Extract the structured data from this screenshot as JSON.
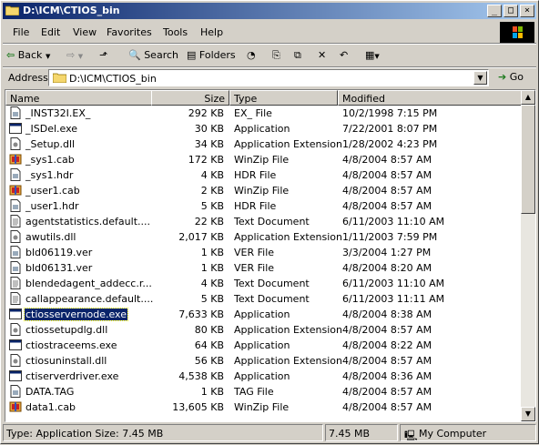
{
  "window": {
    "title": "D:\\ICM\\CTIOS_bin"
  },
  "menu": [
    "File",
    "Edit",
    "View",
    "Favorites",
    "Tools",
    "Help"
  ],
  "toolbar": {
    "back": "Back",
    "search": "Search",
    "folders": "Folders"
  },
  "address": {
    "label": "Address",
    "value": "D:\\ICM\\CTIOS_bin",
    "go": "Go"
  },
  "columns": {
    "name": "Name",
    "size": "Size",
    "type": "Type",
    "modified": "Modified"
  },
  "files": [
    {
      "name": "_INST32I.EX_",
      "size": "292 KB",
      "type": "EX_ File",
      "modified": "10/2/1998 7:15 PM",
      "icon": "generic-file-icon"
    },
    {
      "name": "_ISDel.exe",
      "size": "30 KB",
      "type": "Application",
      "modified": "7/22/2001 8:07 PM",
      "icon": "application-icon"
    },
    {
      "name": "_Setup.dll",
      "size": "34 KB",
      "type": "Application Extension",
      "modified": "1/28/2002 4:23 PM",
      "icon": "dll-icon"
    },
    {
      "name": "_sys1.cab",
      "size": "172 KB",
      "type": "WinZip File",
      "modified": "4/8/2004 8:57 AM",
      "icon": "winzip-icon"
    },
    {
      "name": "_sys1.hdr",
      "size": "4 KB",
      "type": "HDR File",
      "modified": "4/8/2004 8:57 AM",
      "icon": "generic-file-icon"
    },
    {
      "name": "_user1.cab",
      "size": "2 KB",
      "type": "WinZip File",
      "modified": "4/8/2004 8:57 AM",
      "icon": "winzip-icon"
    },
    {
      "name": "_user1.hdr",
      "size": "5 KB",
      "type": "HDR File",
      "modified": "4/8/2004 8:57 AM",
      "icon": "generic-file-icon"
    },
    {
      "name": "agentstatistics.default....",
      "size": "22 KB",
      "type": "Text Document",
      "modified": "6/11/2003 11:10 AM",
      "icon": "text-document-icon"
    },
    {
      "name": "awutils.dll",
      "size": "2,017 KB",
      "type": "Application Extension",
      "modified": "1/11/2003 7:59 PM",
      "icon": "dll-icon"
    },
    {
      "name": "bld06119.ver",
      "size": "1 KB",
      "type": "VER File",
      "modified": "3/3/2004 1:27 PM",
      "icon": "generic-file-icon"
    },
    {
      "name": "bld06131.ver",
      "size": "1 KB",
      "type": "VER File",
      "modified": "4/8/2004 8:20 AM",
      "icon": "generic-file-icon"
    },
    {
      "name": "blendedagent_addecc.r...",
      "size": "4 KB",
      "type": "Text Document",
      "modified": "6/11/2003 11:10 AM",
      "icon": "text-document-icon"
    },
    {
      "name": "callappearance.default....",
      "size": "5 KB",
      "type": "Text Document",
      "modified": "6/11/2003 11:11 AM",
      "icon": "text-document-icon"
    },
    {
      "name": "ctiosservernode.exe",
      "size": "7,633 KB",
      "type": "Application",
      "modified": "4/8/2004 8:38 AM",
      "icon": "application-icon",
      "selected": true
    },
    {
      "name": "ctiossetupdlg.dll",
      "size": "80 KB",
      "type": "Application Extension",
      "modified": "4/8/2004 8:57 AM",
      "icon": "dll-icon"
    },
    {
      "name": "ctiostraceems.exe",
      "size": "64 KB",
      "type": "Application",
      "modified": "4/8/2004 8:22 AM",
      "icon": "application-icon"
    },
    {
      "name": "ctiosuninstall.dll",
      "size": "56 KB",
      "type": "Application Extension",
      "modified": "4/8/2004 8:57 AM",
      "icon": "dll-icon"
    },
    {
      "name": "ctiserverdriver.exe",
      "size": "4,538 KB",
      "type": "Application",
      "modified": "4/8/2004 8:36 AM",
      "icon": "application-icon"
    },
    {
      "name": "DATA.TAG",
      "size": "1 KB",
      "type": "TAG File",
      "modified": "4/8/2004 8:57 AM",
      "icon": "generic-file-icon"
    },
    {
      "name": "data1.cab",
      "size": "13,605 KB",
      "type": "WinZip File",
      "modified": "4/8/2004 8:57 AM",
      "icon": "winzip-icon"
    }
  ],
  "status": {
    "info": "Type: Application Size: 7.45 MB",
    "size": "7.45 MB",
    "zone": "My Computer"
  }
}
